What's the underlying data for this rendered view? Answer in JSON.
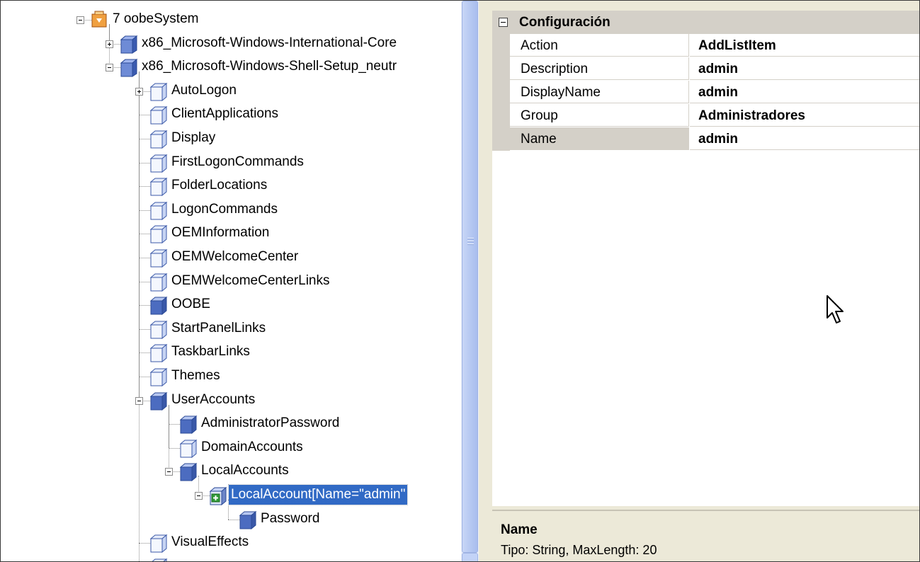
{
  "tree": {
    "nodes": [
      {
        "label": "7 oobeSystem",
        "level": 0,
        "expander": "minus",
        "icon": "pass-icon"
      },
      {
        "label": "x86_Microsoft-Windows-International-Core",
        "level": 1,
        "expander": "plus",
        "icon": "component-icon"
      },
      {
        "label": "x86_Microsoft-Windows-Shell-Setup_neutr",
        "level": 1,
        "expander": "minus",
        "icon": "component-icon"
      },
      {
        "label": "AutoLogon",
        "level": 2,
        "expander": "plus",
        "icon": "setting-icon"
      },
      {
        "label": "ClientApplications",
        "level": 2,
        "expander": "none",
        "icon": "setting-icon"
      },
      {
        "label": "Display",
        "level": 2,
        "expander": "none",
        "icon": "setting-icon"
      },
      {
        "label": "FirstLogonCommands",
        "level": 2,
        "expander": "none",
        "icon": "setting-icon"
      },
      {
        "label": "FolderLocations",
        "level": 2,
        "expander": "none",
        "icon": "setting-icon"
      },
      {
        "label": "LogonCommands",
        "level": 2,
        "expander": "none",
        "icon": "setting-icon"
      },
      {
        "label": "OEMInformation",
        "level": 2,
        "expander": "none",
        "icon": "setting-icon"
      },
      {
        "label": "OEMWelcomeCenter",
        "level": 2,
        "expander": "none",
        "icon": "setting-icon"
      },
      {
        "label": "OEMWelcomeCenterLinks",
        "level": 2,
        "expander": "none",
        "icon": "setting-icon"
      },
      {
        "label": "OOBE",
        "level": 2,
        "expander": "none",
        "icon": "setting-filled-icon"
      },
      {
        "label": "StartPanelLinks",
        "level": 2,
        "expander": "none",
        "icon": "setting-icon"
      },
      {
        "label": "TaskbarLinks",
        "level": 2,
        "expander": "none",
        "icon": "setting-icon"
      },
      {
        "label": "Themes",
        "level": 2,
        "expander": "none",
        "icon": "setting-icon"
      },
      {
        "label": "UserAccounts",
        "level": 2,
        "expander": "minus",
        "icon": "setting-filled-icon"
      },
      {
        "label": "AdministratorPassword",
        "level": 3,
        "expander": "none",
        "icon": "setting-filled-icon"
      },
      {
        "label": "DomainAccounts",
        "level": 3,
        "expander": "none",
        "icon": "setting-icon"
      },
      {
        "label": "LocalAccounts",
        "level": 3,
        "expander": "minus",
        "icon": "setting-filled-icon"
      },
      {
        "label": "LocalAccount[Name=\"admin\"",
        "level": 4,
        "expander": "minus",
        "icon": "list-item-add-icon",
        "selected": true
      },
      {
        "label": "Password",
        "level": 5,
        "expander": "none",
        "icon": "setting-filled-icon"
      },
      {
        "label": "VisualEffects",
        "level": 2,
        "expander": "none",
        "icon": "setting-icon"
      },
      {
        "label": "",
        "level": 2,
        "expander": "none",
        "icon": "setting-icon"
      }
    ]
  },
  "properties": {
    "category": "Configuración",
    "rows": [
      {
        "name": "Action",
        "value": "AddListItem"
      },
      {
        "name": "Description",
        "value": "admin"
      },
      {
        "name": "DisplayName",
        "value": "admin"
      },
      {
        "name": "Group",
        "value": "Administradores"
      },
      {
        "name": "Name",
        "value": "admin",
        "selected": true
      }
    ]
  },
  "description": {
    "title": "Name",
    "text": "Tipo: String, MaxLength: 20"
  },
  "colors": {
    "selection": "#316ac5",
    "panel": "#ece9d8",
    "grid_line": "#d4d0c8",
    "scrollbar": "#b7c9f2"
  }
}
